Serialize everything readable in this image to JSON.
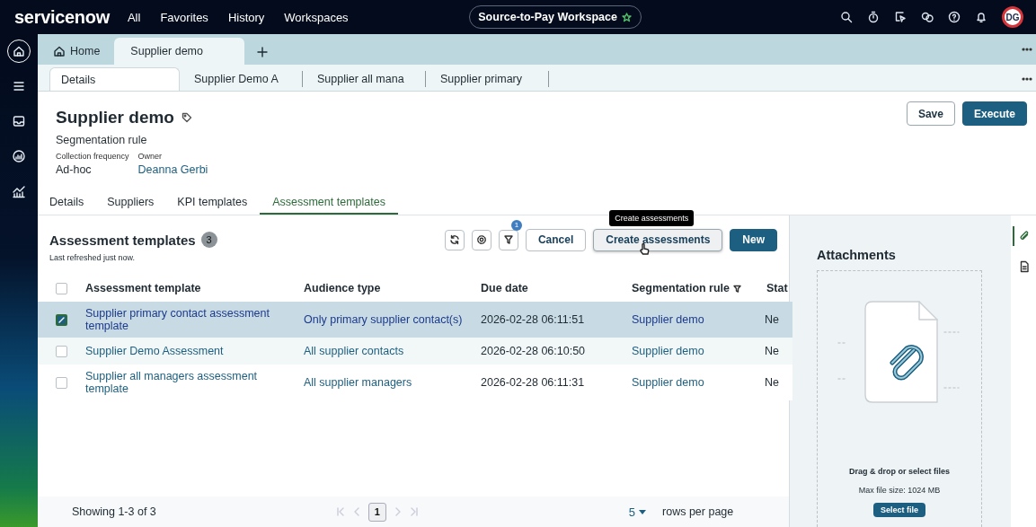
{
  "header": {
    "logo": "servicenow",
    "nav": [
      "All",
      "Favorites",
      "History",
      "Workspaces"
    ],
    "workspace": "Source-to-Pay Workspace",
    "avatar": "DG"
  },
  "rail": [
    {
      "kind": "home",
      "selected": true
    },
    {
      "kind": "list",
      "selected": false
    },
    {
      "kind": "inbox",
      "selected": false
    },
    {
      "kind": "gauge",
      "selected": false
    },
    {
      "kind": "chart",
      "selected": false
    }
  ],
  "tabs": [
    {
      "label": "Home",
      "kind": "home",
      "selected": false
    },
    {
      "label": "Supplier demo",
      "kind": "record",
      "selected": true
    }
  ],
  "subtabs": [
    {
      "label": "Details",
      "selected": true
    },
    {
      "label": "Supplier Demo A",
      "selected": false
    },
    {
      "label": "Supplier all mana",
      "selected": false
    },
    {
      "label": "Supplier primary",
      "selected": false
    }
  ],
  "record": {
    "title": "Supplier demo",
    "subtitle": "Segmentation rule",
    "fields": [
      {
        "label": "Collection frequency",
        "value": "Ad-hoc",
        "kind": "text"
      },
      {
        "label": "Owner",
        "value": "Deanna Gerbi",
        "kind": "link"
      }
    ],
    "buttons": [
      {
        "label": "Save",
        "kind": "secondary"
      },
      {
        "label": "Execute",
        "kind": "primary"
      }
    ]
  },
  "record_tabs": [
    {
      "label": "Details",
      "selected": false
    },
    {
      "label": "Suppliers",
      "selected": false
    },
    {
      "label": "KPI templates",
      "selected": false
    },
    {
      "label": "Assessment templates",
      "selected": true
    }
  ],
  "list": {
    "title": "Assessment templates",
    "count": "3",
    "refreshed": "Last refreshed just now.",
    "filter_count": "1",
    "tooltip": "Create assessments",
    "buttons": [
      {
        "label": "Cancel",
        "kind": "secondary"
      },
      {
        "label": "Create assessments",
        "kind": "hovered"
      },
      {
        "label": "New",
        "kind": "primary"
      }
    ],
    "columns": [
      {
        "label": "Assessment template",
        "filtered": false
      },
      {
        "label": "Audience type",
        "filtered": false
      },
      {
        "label": "Due date",
        "filtered": false
      },
      {
        "label": "Segmentation rule",
        "filtered": true
      },
      {
        "label": "Stat",
        "filtered": false
      }
    ],
    "rows": [
      {
        "selected": true,
        "cells": [
          "Supplier primary contact assessment template",
          "Only primary supplier contact(s)",
          "2026-02-28 06:11:51",
          "Supplier demo",
          "Ne"
        ]
      },
      {
        "selected": false,
        "cells": [
          "Supplier Demo Assessment",
          "All supplier contacts",
          "2026-02-28 06:10:50",
          "Supplier demo",
          "Ne"
        ]
      },
      {
        "selected": false,
        "cells": [
          "Supplier all managers assessment template",
          "All supplier managers",
          "2026-02-28 06:11:31",
          "Supplier demo",
          "Ne"
        ]
      }
    ],
    "all_selected": false,
    "showing": "Showing 1-3 of 3",
    "page": "1",
    "page_size": "5",
    "rows_per_page": "rows per page"
  },
  "attachments": {
    "title": "Attachments",
    "hint": "Drag & drop or select files",
    "max_size": "Max file size: 1024 MB",
    "button": "Select file"
  },
  "side_tabs": [
    {
      "kind": "attachments",
      "selected": true
    },
    {
      "kind": "document",
      "selected": false
    }
  ]
}
